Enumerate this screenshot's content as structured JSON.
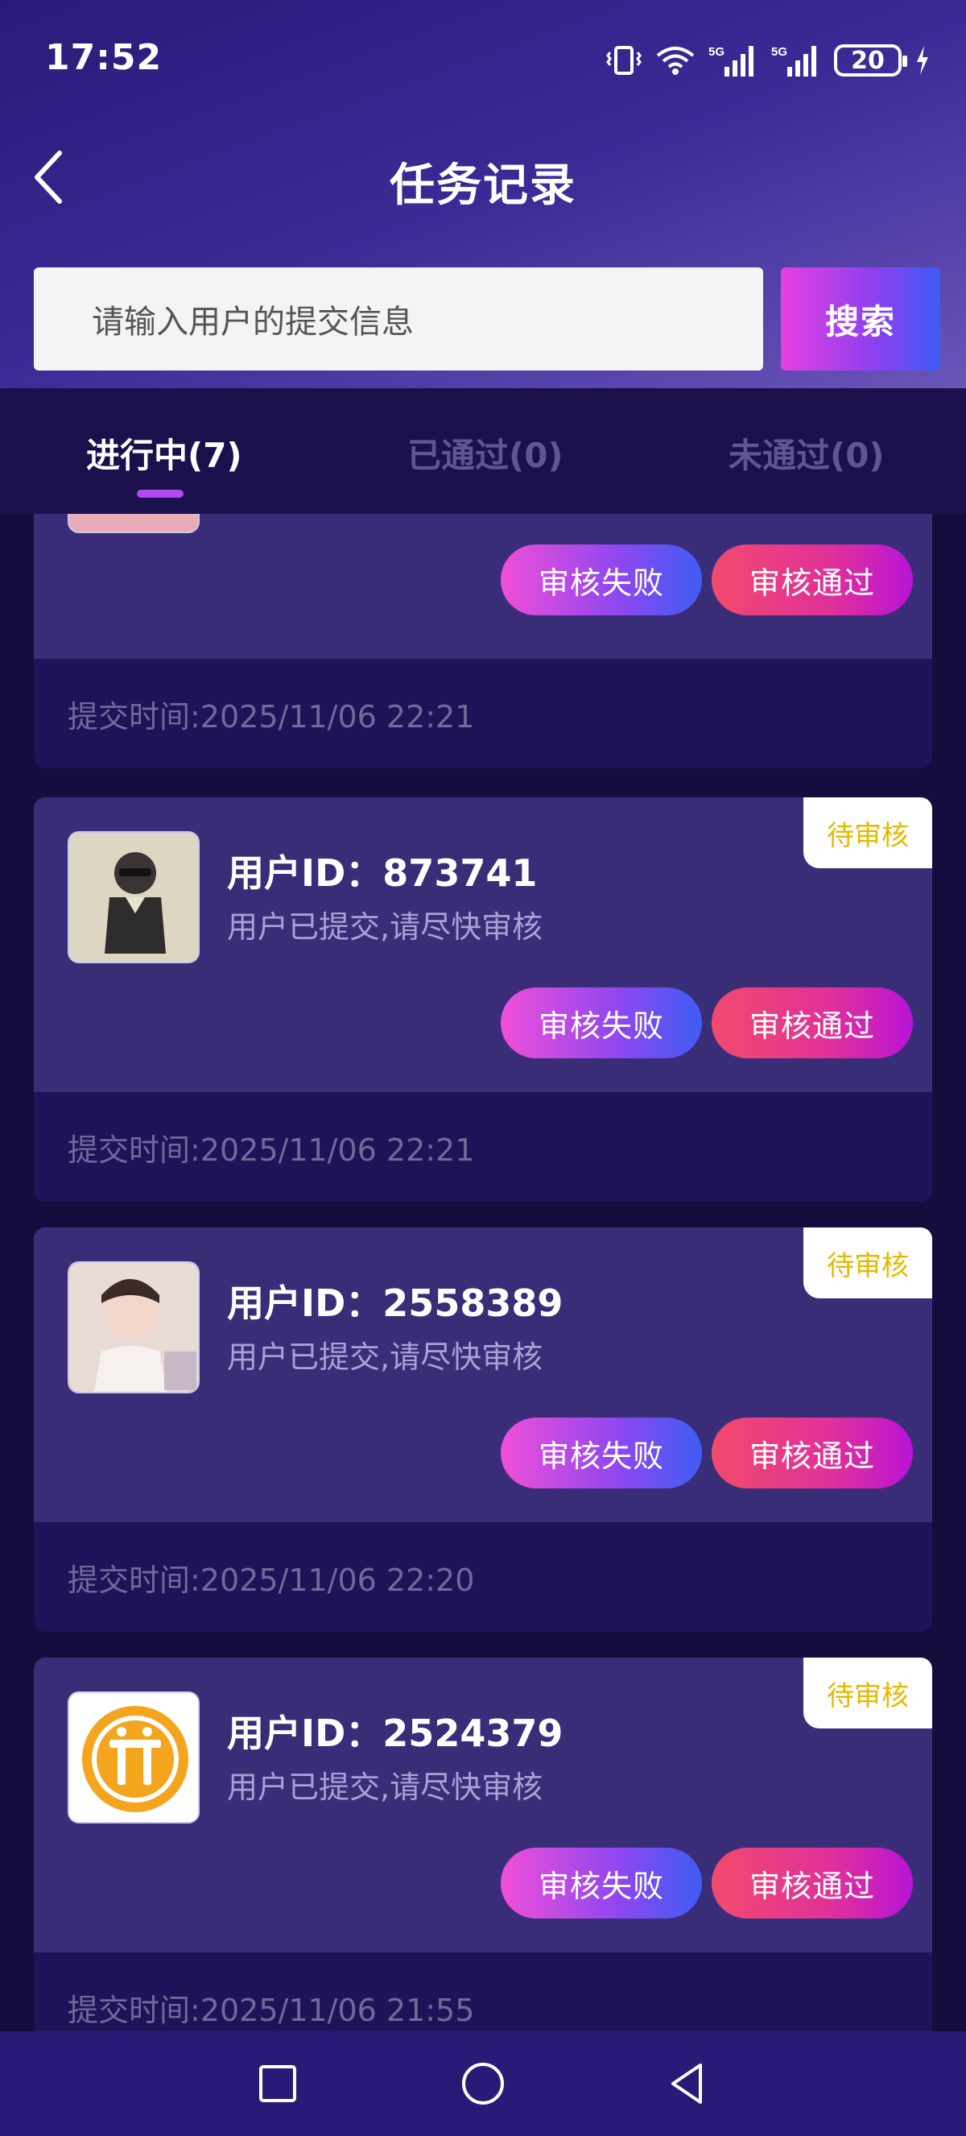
{
  "status_bar": {
    "time": "17:52",
    "network_a": "5G",
    "network_b": "5G",
    "battery": "20"
  },
  "header": {
    "title": "任务记录"
  },
  "search": {
    "placeholder": "请输入用户的提交信息",
    "button_label": "搜索"
  },
  "tabs": [
    {
      "label": "进行中(7)",
      "active": true
    },
    {
      "label": "已通过(0)",
      "active": false
    },
    {
      "label": "未通过(0)",
      "active": false
    }
  ],
  "partial_card": {
    "btn_fail": "审核失败",
    "btn_pass": "审核通过",
    "submit_time": "提交时间:2025/11/06 22:21"
  },
  "cards": [
    {
      "user_id": "用户ID：873741",
      "subtitle": "用户已提交,请尽快审核",
      "badge": "待审核",
      "btn_fail": "审核失败",
      "btn_pass": "审核通过",
      "submit_time": "提交时间:2025/11/06 22:21"
    },
    {
      "user_id": "用户ID：2558389",
      "subtitle": "用户已提交,请尽快审核",
      "badge": "待审核",
      "btn_fail": "审核失败",
      "btn_pass": "审核通过",
      "submit_time": "提交时间:2025/11/06 22:20"
    },
    {
      "user_id": "用户ID：2524379",
      "subtitle": "用户已提交,请尽快审核",
      "badge": "待审核",
      "btn_fail": "审核失败",
      "btn_pass": "审核通过",
      "submit_time": "提交时间:2025/11/06 21:55"
    }
  ],
  "colors": {
    "accent_purple": "#b248f0",
    "badge_text": "#e6b800",
    "card_bg": "#3a2d78"
  }
}
